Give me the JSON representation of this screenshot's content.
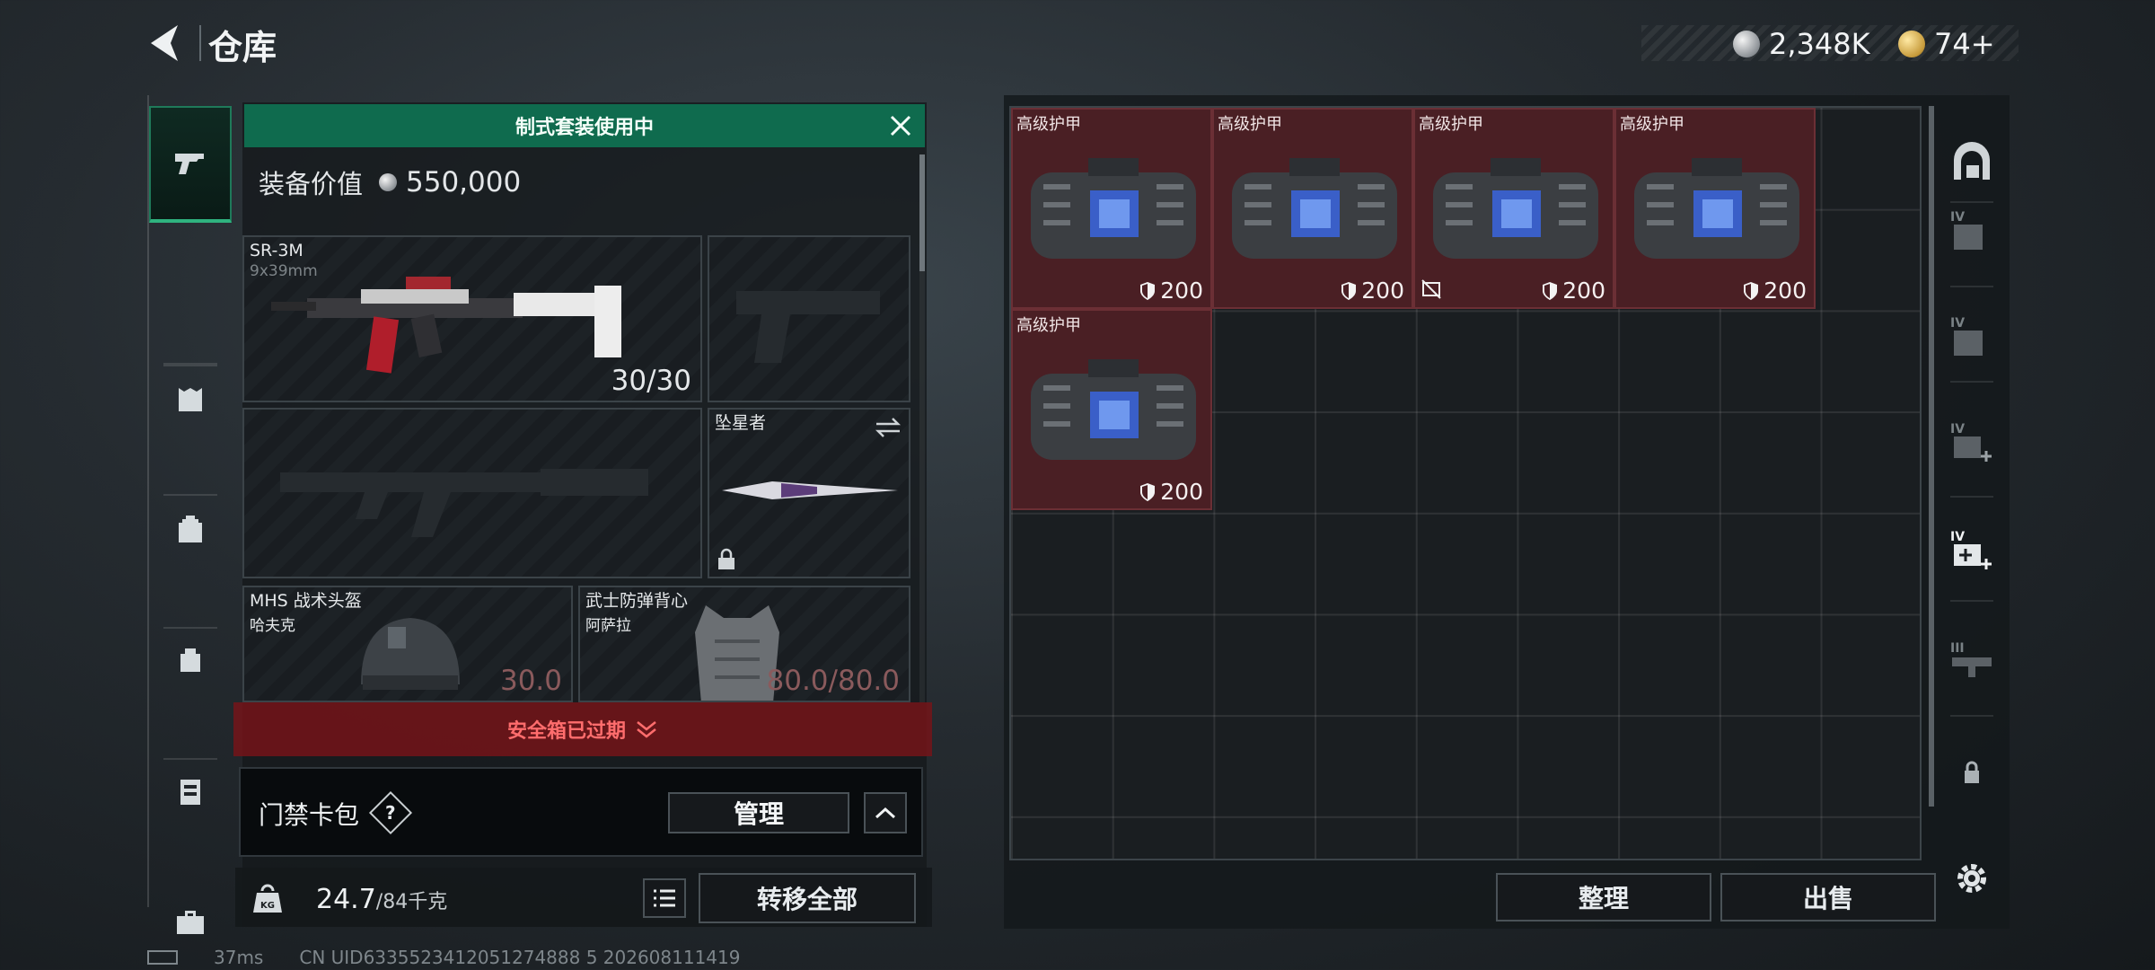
{
  "header": {
    "title": "仓库",
    "currency": [
      {
        "icon": "silver-coin-icon",
        "value": "2,348K"
      },
      {
        "icon": "gold-coin-icon",
        "value": "74+"
      }
    ]
  },
  "loadout": {
    "banner": "制式套装使用中",
    "value_label": "装备价值",
    "value": "550,000",
    "primary": {
      "name": "SR-3M",
      "caliber": "9x39mm",
      "ammo": "30/30"
    },
    "melee": {
      "name": "坠星者"
    },
    "helmet": {
      "name": "MHS 战术头盔",
      "sub": "哈夫克",
      "durability": "30.0"
    },
    "vest": {
      "name": "武士防弹背心",
      "sub": "阿萨拉",
      "durability": "80.0/80.0"
    },
    "safe_box_notice": "安全箱已过期",
    "card_wallet": {
      "title": "门禁卡包",
      "help": "?",
      "manage": "管理"
    },
    "weight": {
      "current": "24.7",
      "max": "/84千克"
    },
    "transfer_all": "转移全部"
  },
  "storage": {
    "items": [
      {
        "label": "高级护甲",
        "value": "200",
        "warn": false
      },
      {
        "label": "高级护甲",
        "value": "200",
        "warn": false
      },
      {
        "label": "高级护甲",
        "value": "200",
        "warn": true
      },
      {
        "label": "高级护甲",
        "value": "200",
        "warn": false
      },
      {
        "label": "高级护甲",
        "value": "200",
        "warn": false
      }
    ],
    "sort": "整理",
    "sell": "出售"
  },
  "status": {
    "ping": "37ms",
    "uid": "CN UID6335523412051274888 5 202608111419"
  },
  "colors": {
    "accent_green": "#0f6b4e",
    "item_red": "#4a1f24",
    "alert_red": "#ff6d6d"
  }
}
